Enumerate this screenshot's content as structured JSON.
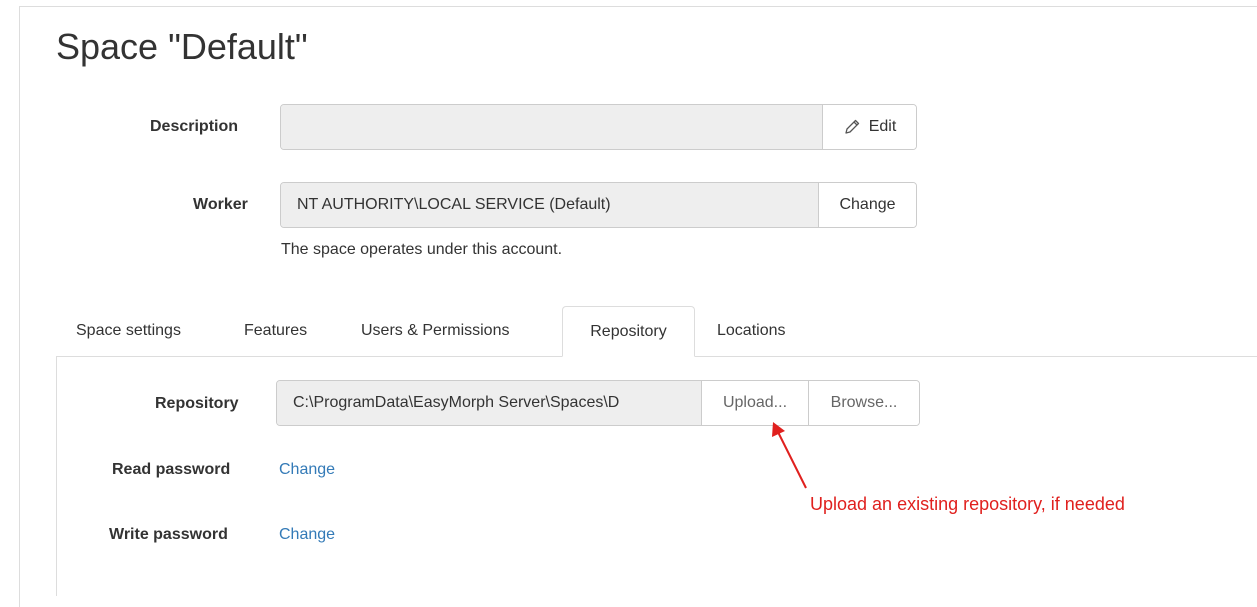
{
  "page": {
    "title": "Space \"Default\""
  },
  "description": {
    "label": "Description",
    "value": "",
    "edit_label": "Edit",
    "edit_icon": "pencil-icon"
  },
  "worker": {
    "label": "Worker",
    "value": "NT AUTHORITY\\LOCAL SERVICE (Default)",
    "change_label": "Change",
    "help": "The space operates under this account."
  },
  "tabs": [
    {
      "label": "Space settings",
      "active": false
    },
    {
      "label": "Features",
      "active": false
    },
    {
      "label": "Users & Permissions",
      "active": false
    },
    {
      "label": "Repository",
      "active": true
    },
    {
      "label": "Locations",
      "active": false
    }
  ],
  "repository": {
    "label": "Repository",
    "path": "C:\\ProgramData\\EasyMorph Server\\Spaces\\D",
    "upload_label": "Upload...",
    "browse_label": "Browse...",
    "read_password_label": "Read password",
    "read_password_action": "Change",
    "write_password_label": "Write password",
    "write_password_action": "Change"
  },
  "annotation": {
    "text": "Upload an existing repository, if needed",
    "color": "#e0201e"
  },
  "colors": {
    "link": "#337ab7",
    "field_bg": "#eeeeee",
    "border": "#cccccc"
  }
}
